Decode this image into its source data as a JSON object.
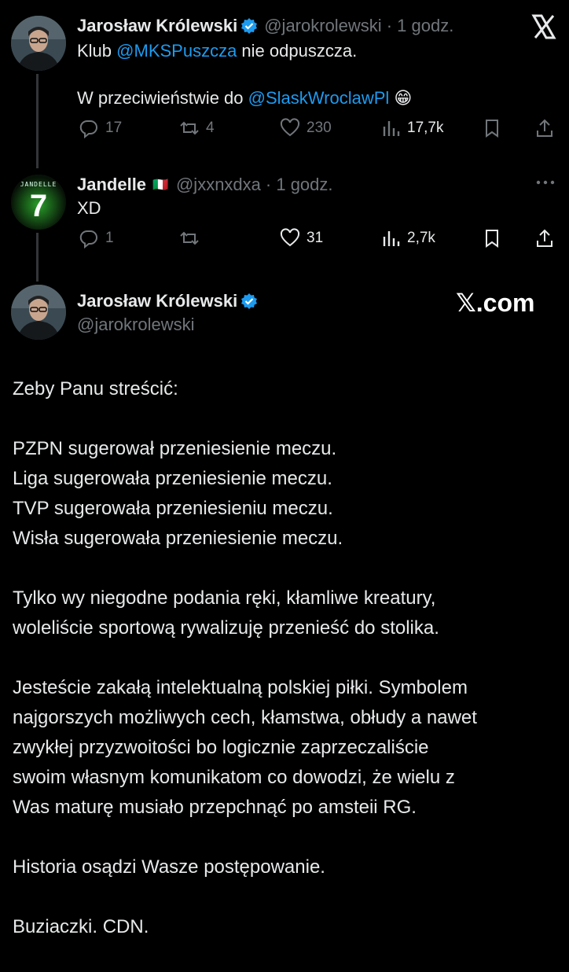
{
  "header": {
    "x_logo": "X"
  },
  "tweet1": {
    "author": "Jarosław Królewski",
    "handle": "@jarokrolewski",
    "time": "· 1 godz.",
    "line1_pre": "Klub ",
    "line1_link": "@MKSPuszcza",
    "line1_post": " nie odpuszcza.",
    "line2_pre": "W przeciwieństwie do ",
    "line2_link": "@SlaskWroclawPl",
    "emoji": "😁",
    "replies": "17",
    "retweets": "4",
    "likes": "230",
    "views": "17,7k"
  },
  "tweet2": {
    "author": "Jandelle",
    "flag": "🇮🇹",
    "handle": "@jxxnxdxa",
    "time": "· 1 godz.",
    "text": "XD",
    "replies": "1",
    "retweets": "",
    "likes": "31",
    "views": "2,7k",
    "avatar_text": "JANDELLE",
    "avatar_number": "7"
  },
  "main": {
    "author": "Jarosław Królewski",
    "handle": "@jarokrolewski",
    "watermark": "𝕏.com",
    "paragraphs": [
      "Zeby Panu streścić:",
      "PZPN sugerował przeniesienie meczu.\nLiga sugerowała przeniesienie meczu.\nTVP sugerowała przeniesieniu meczu.\nWisła sugerowała przeniesienie meczu.",
      "Tylko wy niegodne podania ręki, kłamliwe kreatury,\nwoleliście sportową rywalizuję przenieść do stolika.",
      "Jesteście zakałą intelektualną polskiej piłki. Symbolem\nnajgorszych możliwych cech, kłamstwa, obłudy a nawet\nzwykłej przyzwoitości bo logicznie zaprzeczaliście\nswoim własnym komunikatom co dowodzi, że wielu z\nWas maturę musiało przepchnąć po amsteii RG.",
      "Historia osądzi Wasze postępowanie.",
      "Buziaczki. CDN."
    ]
  },
  "colors": {
    "background": "#000000",
    "text": "#e7e9ea",
    "muted": "#71767b",
    "link": "#1d9bf0",
    "verified": "#1d9bf0"
  }
}
